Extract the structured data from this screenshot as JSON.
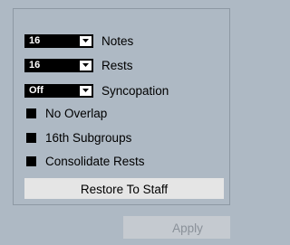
{
  "settings": {
    "notes": {
      "value": "16",
      "label": "Notes"
    },
    "rests": {
      "value": "16",
      "label": "Rests"
    },
    "syncopation": {
      "value": "Off",
      "label": "Syncopation"
    }
  },
  "options": {
    "no_overlap": {
      "label": "No Overlap",
      "checked": true
    },
    "subgroups": {
      "label": "16th Subgroups",
      "checked": true
    },
    "consolidate_rests": {
      "label": "Consolidate Rests",
      "checked": true
    }
  },
  "buttons": {
    "restore": "Restore To Staff",
    "apply": "Apply"
  },
  "colors": {
    "panel_bg": "#aeb9c4",
    "restore_bg": "#e5e5e5",
    "apply_bg": "#c5cad0",
    "apply_text_disabled": "#8a9199"
  }
}
